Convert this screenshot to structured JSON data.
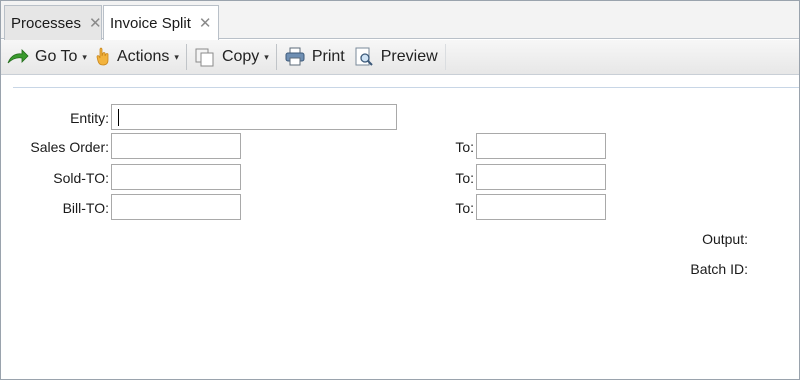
{
  "tabs": [
    {
      "label": "Processes",
      "close": "✕"
    },
    {
      "label": "Invoice Split",
      "close": "✕"
    }
  ],
  "toolbar": {
    "goto_label": "Go To",
    "actions_label": "Actions",
    "copy_label": "Copy",
    "print_label": "Print",
    "preview_label": "Preview",
    "caret": "▾"
  },
  "form": {
    "entity_label": "Entity:",
    "entity_value": "",
    "sales_order_label": "Sales Order:",
    "sales_order_value": "",
    "sales_order_to_label": "To:",
    "sales_order_to_value": "",
    "sold_to_label": "Sold-TO:",
    "sold_to_value": "",
    "sold_to_to_label": "To:",
    "sold_to_to_value": "",
    "bill_to_label": "Bill-TO:",
    "bill_to_value": "",
    "bill_to_to_label": "To:",
    "bill_to_to_value": "",
    "output_label": "Output:",
    "batch_id_label": "Batch ID:"
  }
}
